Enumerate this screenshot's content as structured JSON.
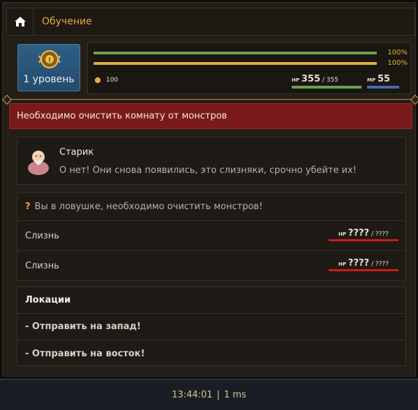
{
  "header": {
    "title": "Обучение",
    "home_icon": "home-icon"
  },
  "character": {
    "level_label": "1 уровень",
    "emblem_icon": "level-emblem-icon",
    "bar1_pct": "100%",
    "bar2_pct": "100%",
    "gold": "100",
    "hp_tag": "HP",
    "hp_current": "355",
    "hp_max": "355",
    "mp_tag": "MP",
    "mp_current": "55"
  },
  "quest": {
    "banner": "Необходимо очистить комнату от монстров"
  },
  "dialog": {
    "speaker": "Старик",
    "text": "О нет! Они снова появились, это слизняки, срочно убейте их!",
    "avatar_icon": "old-man-avatar"
  },
  "encounter": {
    "hint_mark": "?",
    "hint": "Вы в ловушке, необходимо очистить монстров!",
    "monsters": [
      {
        "name": "Слизнь",
        "hp_tag": "HP",
        "hp_current": "????",
        "hp_max": "????"
      },
      {
        "name": "Слизнь",
        "hp_tag": "HP",
        "hp_current": "????",
        "hp_max": "????"
      }
    ]
  },
  "locations": {
    "title": "Локации",
    "items": [
      "- Отправить на запад!",
      "- Отправить на восток!"
    ]
  },
  "footer": {
    "time": "13:44:01",
    "separator": "|",
    "latency": "1 ms"
  },
  "colors": {
    "accent_gold": "#e3a94a",
    "banner_red": "#7a1a1a",
    "hp_green": "#6aa34f",
    "xp_yellow": "#d8b43a",
    "mp_blue": "#4b69ad",
    "monster_hp_red": "#d01a1a",
    "level_blue": "#2e5f85"
  }
}
